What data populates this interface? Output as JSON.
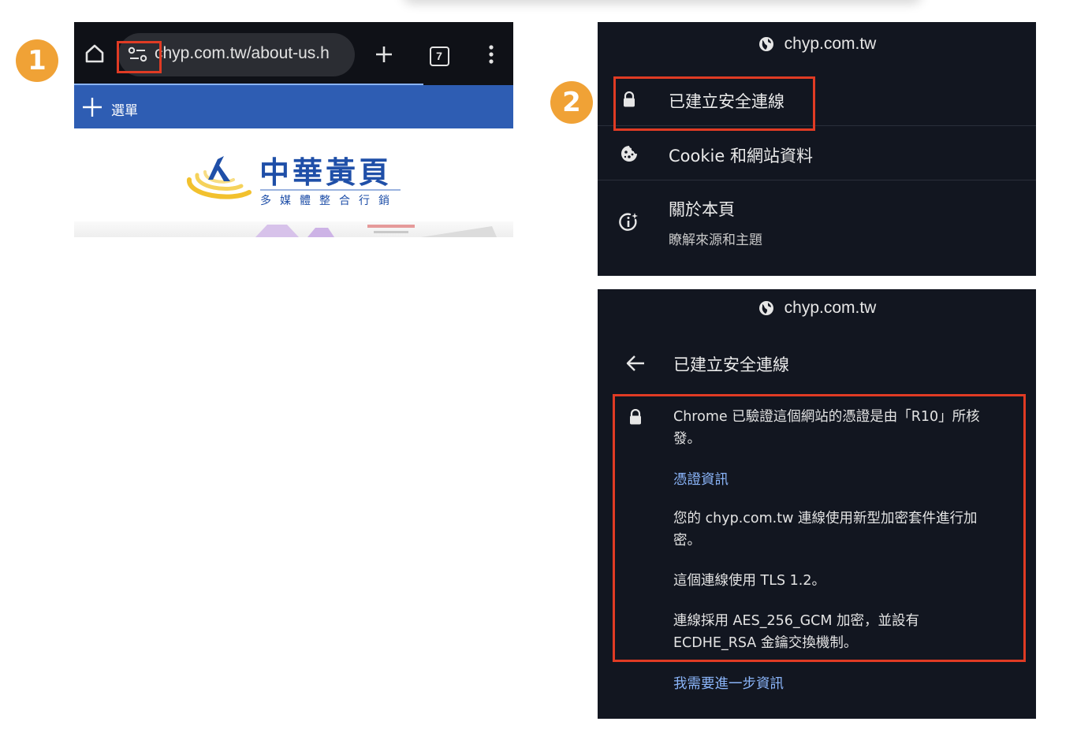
{
  "badges": {
    "step1": "1",
    "step2": "2"
  },
  "phone": {
    "url_text": "chyp.com.tw/about-us.h",
    "tab_count": "7",
    "site_menu_label": "選單",
    "logo_title": "中華黃頁",
    "logo_subtitle": "多媒體整合行銷"
  },
  "site_info": {
    "domain": "chyp.com.tw",
    "rows": [
      {
        "label": "已建立安全連線",
        "icon": "lock-icon"
      },
      {
        "label": "Cookie 和網站資料",
        "icon": "cookie-icon"
      },
      {
        "label": "關於本頁",
        "sublabel": "瞭解來源和主題",
        "icon": "about-page-icon"
      }
    ]
  },
  "security_details": {
    "domain": "chyp.com.tw",
    "title": "已建立安全連線",
    "verified_text": "Chrome 已驗證這個網站的憑證是由「R10」所核發。",
    "certificate_link": "憑證資訊",
    "encryption_text": "您的 chyp.com.tw 連線使用新型加密套件進行加密。",
    "tls_text": "這個連線使用 TLS 1.2。",
    "cipher_text": "連線採用 AES_256_GCM 加密，並設有 ECDHE_RSA 金鑰交換機制。",
    "learn_more_link": "我需要進一步資訊"
  },
  "colors": {
    "badge": "#f0a236",
    "highlight": "#e03b24",
    "panel_bg": "#121620",
    "link": "#8ab4f8",
    "site_menu_bg": "#2e5db3"
  }
}
